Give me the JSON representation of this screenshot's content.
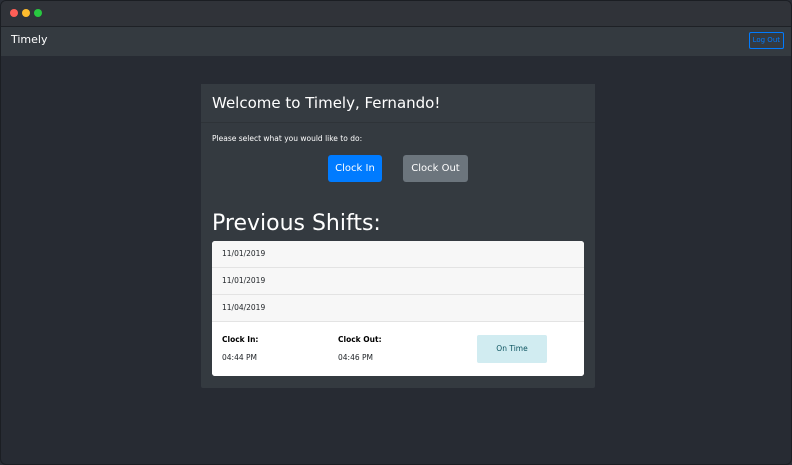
{
  "navbar": {
    "brand": "Timely",
    "logout_label": "Log Out"
  },
  "card": {
    "welcome": "Welcome to Timely, Fernando!",
    "prompt": "Please select what you would like to do:",
    "clock_in_label": "Clock In",
    "clock_out_label": "Clock Out",
    "previous_title": "Previous Shifts:"
  },
  "shifts": [
    {
      "date": "11/01/2019"
    },
    {
      "date": "11/01/2019"
    },
    {
      "date": "11/04/2019"
    }
  ],
  "shift_detail": {
    "clock_in_label": "Clock In:",
    "clock_in_value": "04:44 PM",
    "clock_out_label": "Clock Out:",
    "clock_out_value": "04:46 PM",
    "status": "On Time"
  },
  "colors": {
    "primary": "#007bff",
    "secondary": "#6c757d",
    "info_bg": "#d1ecf1",
    "info_text": "#0c5460"
  }
}
